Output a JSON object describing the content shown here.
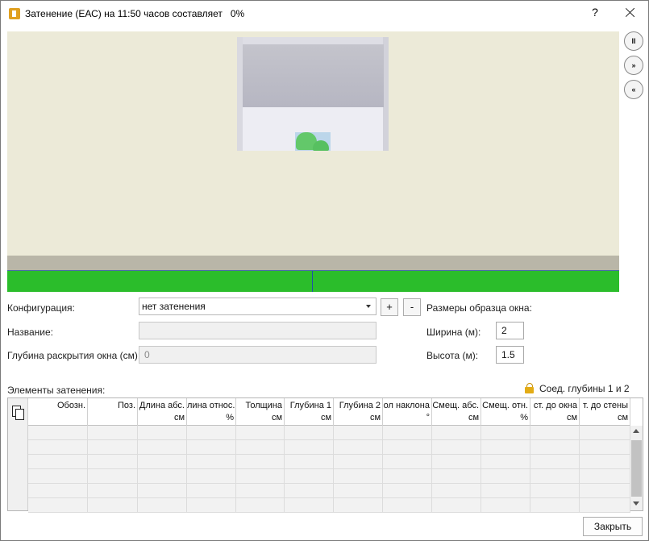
{
  "window": {
    "title": "Затенение (ЕАС) на 11:50 часов составляет",
    "percent": "0%",
    "help": "?"
  },
  "playback": {
    "pause": "II",
    "forward": "»",
    "back": "«"
  },
  "form": {
    "config_label": "Конфигурация:",
    "config_value": "нет затенения",
    "add": "+",
    "remove": "-",
    "name_label": "Название:",
    "name_value": "",
    "depth_label": "Глубина раскрытия окна (см):",
    "depth_value": "0",
    "sample_label": "Размеры образца окна:",
    "width_label": "Ширина (м):",
    "width_value": "2",
    "height_label": "Высота (м):",
    "height_value": "1.5"
  },
  "elements": {
    "label": "Элементы затенения:",
    "link_label": "Соед. глубины 1 и 2",
    "columns": [
      {
        "line1": "Обозн.",
        "line2": ""
      },
      {
        "line1": "Поз.",
        "line2": ""
      },
      {
        "line1": "Длина абс.",
        "line2": "см"
      },
      {
        "line1": "лина относ.",
        "line2": "%"
      },
      {
        "line1": "Толщина",
        "line2": "см"
      },
      {
        "line1": "Глубина 1",
        "line2": "см"
      },
      {
        "line1": "Глубина 2",
        "line2": "см"
      },
      {
        "line1": "ол наклона",
        "line2": "°"
      },
      {
        "line1": "Смещ. абс.",
        "line2": "см"
      },
      {
        "line1": "Смещ. отн.",
        "line2": "%"
      },
      {
        "line1": "ст. до окна",
        "line2": "см"
      },
      {
        "line1": "т. до стены",
        "line2": "см"
      }
    ]
  },
  "footer": {
    "close": "Закрыть"
  }
}
